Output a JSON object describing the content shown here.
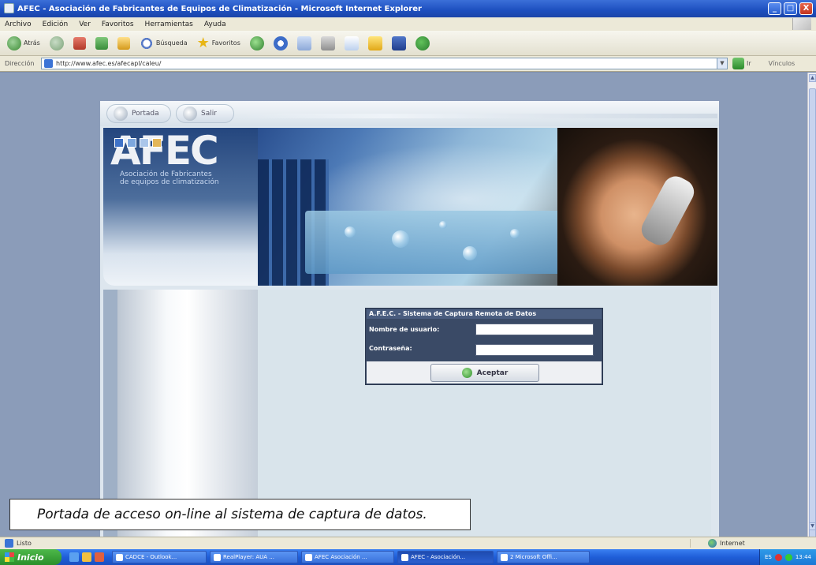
{
  "window": {
    "title": "AFEC - Asociación de Fabricantes de Equipos de Climatización - Microsoft Internet Explorer",
    "controls": [
      "_",
      "□",
      "X"
    ]
  },
  "menubar": {
    "items": [
      "Archivo",
      "Edición",
      "Ver",
      "Favoritos",
      "Herramientas",
      "Ayuda"
    ]
  },
  "toolbar": {
    "back_label": "Atrás",
    "search_label": "Búsqueda",
    "favorites_label": "Favoritos"
  },
  "addressbar": {
    "label": "Dirección",
    "url": "http://www.afec.es/afecapl/caleu/",
    "go_label": "Ir",
    "links_label": "Vínculos"
  },
  "site": {
    "nav_tabs": [
      "Portada",
      "Salir"
    ],
    "logo_letters": "AFEC",
    "logo_subtitle_line1": "Asociación de Fabricantes",
    "logo_subtitle_line2": "de equipos de climatización"
  },
  "login": {
    "title": "A.F.E.C. - Sistema de Captura Remota de Datos",
    "username_label": "Nombre de usuario:",
    "password_label": "Contraseña:",
    "username_value": "",
    "password_value": "",
    "submit_label": "Aceptar"
  },
  "caption": "Portada de acceso on-line al sistema de captura de datos.",
  "statusbar": {
    "left_text": "Listo",
    "zone_text": "Internet"
  },
  "taskbar": {
    "start_label": "Inicio",
    "tasks": [
      "CADCE - Outlook...",
      "RealPlayer: AUA ...",
      "AFEC Asociación ...",
      "AFEC - Asociación...",
      "2 Microsoft Offi..."
    ],
    "tray_lang": "ES",
    "clock": "13:44"
  }
}
